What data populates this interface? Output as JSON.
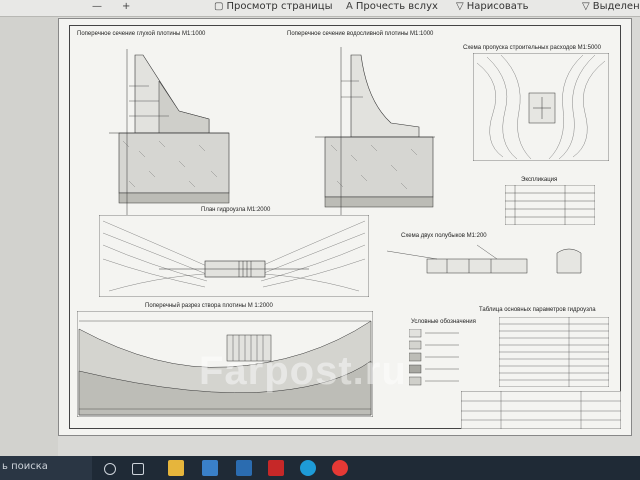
{
  "toolbar": {
    "items": [
      {
        "icon": "minus-icon",
        "label": ""
      },
      {
        "icon": "plus-icon",
        "label": ""
      },
      {
        "icon": "page-view-icon",
        "label": "Просмотр страницы"
      },
      {
        "icon": "read-aloud-icon",
        "label": "Прочесть вслух"
      },
      {
        "icon": "draw-icon",
        "label": "Нарисовать"
      },
      {
        "icon": "highlight-icon",
        "label": "Выделение"
      }
    ]
  },
  "drawing": {
    "title_dam_section": "Поперечное сечение глухой плотины М1:1000",
    "title_spillway_section": "Поперечное сечение водосливной плотины М1:1000",
    "title_diversion": "Схема пропуска строительных расходов М1:5000",
    "title_explication": "Экспликация",
    "title_plan": "План гидроузла М1:2000",
    "title_cofferdam": "Схема двух полубыков М1:200",
    "title_cross_section": "Поперечный разрез створа плотины М 1:2000",
    "title_legend": "Условные обозначения",
    "title_params_table": "Таблица основных параметров гидроузла"
  },
  "watermark": "Farpost.ru",
  "taskbar": {
    "search_text": "ь поиска",
    "icons": [
      "start-icon",
      "task-view-icon",
      "file-explorer-icon",
      "store-icon",
      "mail-icon",
      "autocad-icon",
      "edge-icon",
      "chrome-icon"
    ]
  },
  "colors": {
    "taskbar": "#1f2a36",
    "sheet": "#f4f4f1",
    "toolbar": "#e8e8e6"
  }
}
